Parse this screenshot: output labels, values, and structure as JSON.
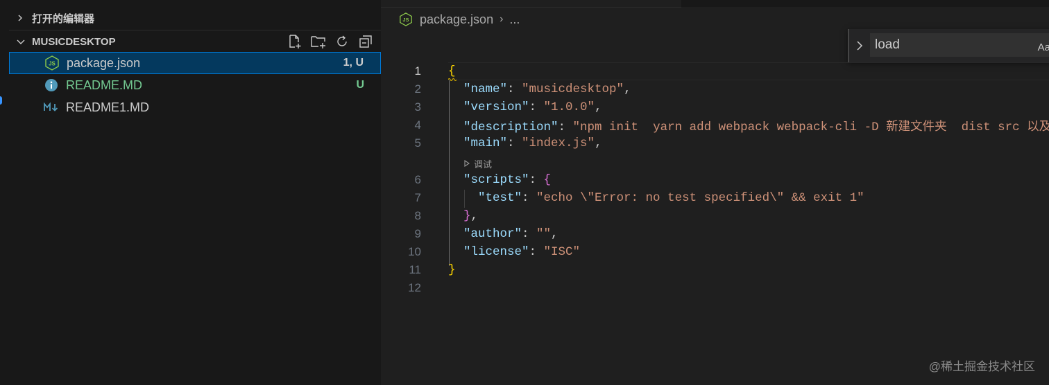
{
  "sidebar": {
    "open_editors_title": "打开的编辑器",
    "project_title": "MUSICDESKTOP",
    "actions": [
      "new-file-icon",
      "new-folder-icon",
      "refresh-icon",
      "collapse-all-icon"
    ],
    "files": [
      {
        "name": "package.json",
        "badge": "1, U",
        "icon": "nodejs-icon",
        "selected": true
      },
      {
        "name": "README.MD",
        "badge": "U",
        "icon": "info-icon",
        "selected": false
      },
      {
        "name": "README1.MD",
        "badge": "",
        "icon": "markdown-icon",
        "selected": false
      }
    ]
  },
  "editor": {
    "breadcrumb": {
      "file": "package.json",
      "sep": "›",
      "more": "..."
    },
    "find": {
      "value": "load",
      "match_case_label": "Aa"
    },
    "codelens": "调试",
    "line_numbers": [
      "1",
      "2",
      "3",
      "4",
      "5",
      "6",
      "7",
      "8",
      "9",
      "10",
      "11",
      "12"
    ],
    "code": {
      "l1": "{",
      "name_key": "\"name\"",
      "name_val": "\"musicdesktop\"",
      "version_key": "\"version\"",
      "version_val": "\"1.0.0\"",
      "desc_key": "\"description\"",
      "desc_val": "\"npm init  yarn add webpack webpack-cli -D 新建文件夹  dist src 以及",
      "main_key": "\"main\"",
      "main_val": "\"index.js\"",
      "scripts_key": "\"scripts\"",
      "scripts_open": "{",
      "test_key": "\"test\"",
      "test_val": "\"echo \\\"Error: no test specified\\\" && exit 1\"",
      "scripts_close": "}",
      "author_key": "\"author\"",
      "author_val": "\"\"",
      "license_key": "\"license\"",
      "license_val": "\"ISC\"",
      "l11": "}"
    }
  },
  "watermark": "@稀土掘金技术社区",
  "colors": {
    "accent": "#0078d4",
    "untracked": "#73c991",
    "key": "#9cdcfe",
    "string": "#ce9178"
  }
}
